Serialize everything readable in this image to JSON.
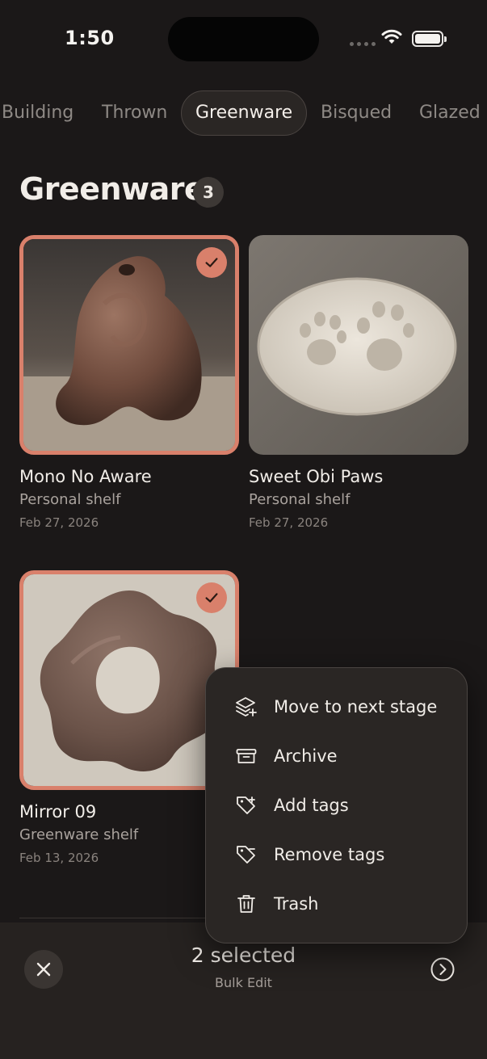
{
  "status_bar": {
    "time": "1:50"
  },
  "tabs": [
    {
      "label": "Building"
    },
    {
      "label": "Thrown"
    },
    {
      "label": "Greenware"
    },
    {
      "label": "Bisqued"
    },
    {
      "label": "Glazed"
    }
  ],
  "active_tab": "Greenware",
  "header": {
    "title": "Greenware",
    "count": "3"
  },
  "items": [
    {
      "title": "Mono No Aware",
      "shelf": "Personal shelf",
      "date": "Feb 27, 2026",
      "selected": true
    },
    {
      "title": "Sweet Obi Paws",
      "shelf": "Personal shelf",
      "date": "Feb 27, 2026",
      "selected": false
    },
    {
      "title": "Mirror 09",
      "shelf": "Greenware shelf",
      "date": "Feb 13, 2026",
      "selected": true
    }
  ],
  "menu": {
    "items": [
      {
        "label": "Move to next stage",
        "icon": "layers-plus-icon"
      },
      {
        "label": "Archive",
        "icon": "archive-icon"
      },
      {
        "label": "Add tags",
        "icon": "tag-plus-icon"
      },
      {
        "label": "Remove tags",
        "icon": "tag-minus-icon"
      },
      {
        "label": "Trash",
        "icon": "trash-icon"
      }
    ]
  },
  "bottom_bar": {
    "selected_label": "2 selected",
    "mode_label": "Bulk Edit"
  },
  "colors": {
    "accent": "#d9806b",
    "background": "#1b1818",
    "panel": "#262220"
  }
}
